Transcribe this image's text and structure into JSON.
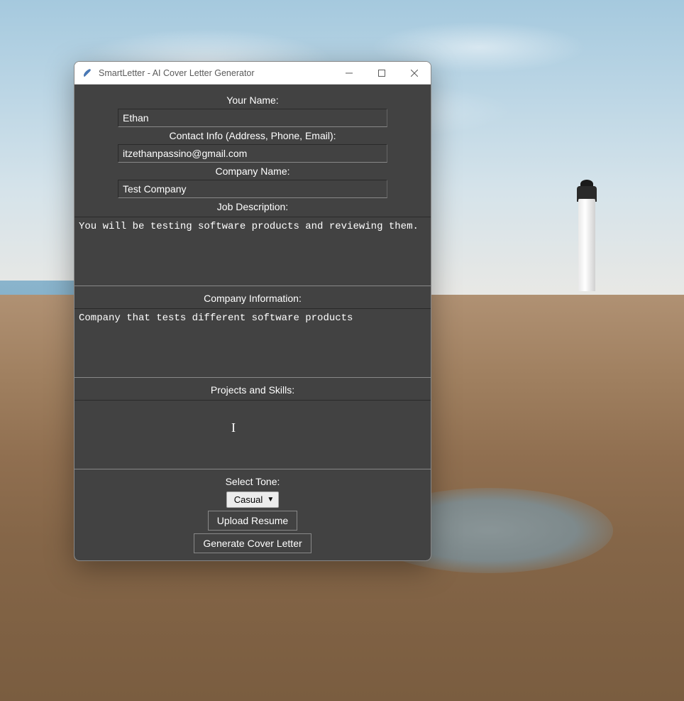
{
  "window": {
    "title": "SmartLetter - AI Cover Letter Generator"
  },
  "form": {
    "name_label": "Your Name:",
    "name_value": "Ethan",
    "contact_label": "Contact Info (Address, Phone, Email):",
    "contact_value": "itzethanpassino@gmail.com",
    "company_label": "Company Name:",
    "company_value": "Test Company",
    "job_desc_label": "Job Description:",
    "job_desc_value": "You will be testing software products and reviewing them.",
    "company_info_label": "Company Information:",
    "company_info_value": "Company that tests different software products",
    "projects_label": "Projects and Skills:",
    "projects_value": "",
    "tone_label": "Select Tone:",
    "tone_selected": "Casual",
    "upload_button": "Upload Resume",
    "generate_button": "Generate Cover Letter"
  }
}
